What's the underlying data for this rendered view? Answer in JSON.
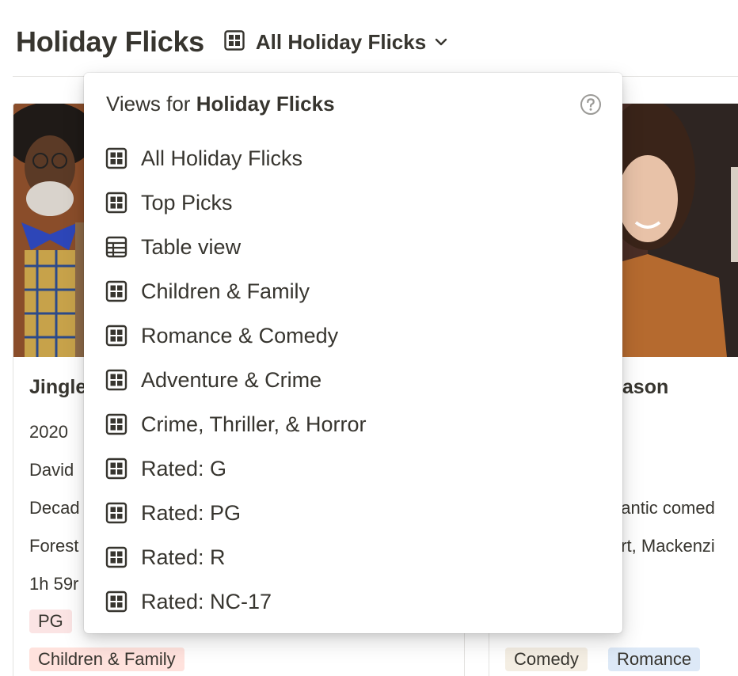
{
  "header": {
    "title": "Holiday Flicks",
    "current_view": "All Holiday Flicks"
  },
  "cards": {
    "left": {
      "title": "Jingle",
      "year": "2020",
      "line2": "David",
      "line3": "Decad",
      "line4": "Forest",
      "line5": "1h 59r",
      "rating_tag": "PG",
      "genre_tag": "Children & Family"
    },
    "right": {
      "title": "eason",
      "line3": "nantic comed",
      "line4": "art, Mackenzi",
      "tags": [
        "Comedy",
        "Romance"
      ]
    }
  },
  "dropdown": {
    "heading_prefix": "Views for ",
    "heading_db": "Holiday Flicks",
    "help_icon": "question-circle-icon",
    "items": [
      {
        "label": "All Holiday Flicks",
        "icon": "gallery-icon"
      },
      {
        "label": "Top Picks",
        "icon": "gallery-icon"
      },
      {
        "label": "Table view",
        "icon": "table-icon"
      },
      {
        "label": "Children & Family",
        "icon": "gallery-icon"
      },
      {
        "label": "Romance & Comedy",
        "icon": "gallery-icon"
      },
      {
        "label": "Adventure & Crime",
        "icon": "gallery-icon"
      },
      {
        "label": "Crime, Thriller, & Horror",
        "icon": "gallery-icon"
      },
      {
        "label": "Rated: G",
        "icon": "gallery-icon"
      },
      {
        "label": "Rated: PG",
        "icon": "gallery-icon"
      },
      {
        "label": "Rated: R",
        "icon": "gallery-icon"
      },
      {
        "label": "Rated: NC-17",
        "icon": "gallery-icon"
      }
    ]
  },
  "colors": {
    "text": "#37352f",
    "tag_pg": "#fbe4e4",
    "tag_children_family": "#ffe2dd",
    "tag_comedy": "#f4eee3",
    "tag_romance": "#dde9f7"
  }
}
